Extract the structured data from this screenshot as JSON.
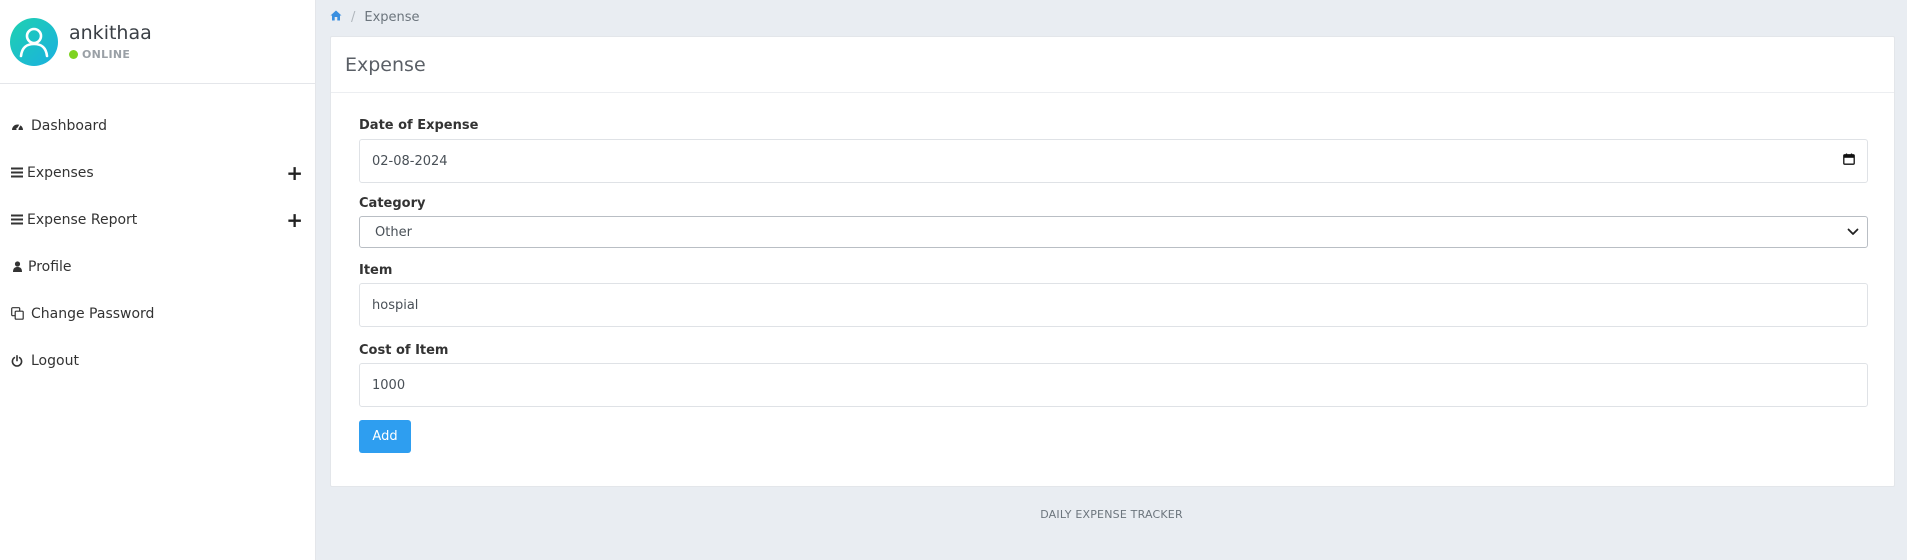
{
  "user": {
    "name": "ankithaa",
    "status": "ONLINE"
  },
  "sidebar": {
    "items": [
      {
        "label": "Dashboard",
        "icon": "dashboard-icon"
      },
      {
        "label": "Expenses",
        "icon": "bars-icon",
        "expandable": true
      },
      {
        "label": "Expense Report",
        "icon": "bars-icon",
        "expandable": true
      },
      {
        "label": "Profile",
        "icon": "user-icon"
      },
      {
        "label": "Change Password",
        "icon": "copy-icon"
      },
      {
        "label": "Logout",
        "icon": "power-icon"
      }
    ],
    "expand_symbol": "+"
  },
  "breadcrumb": {
    "home_icon": "home-icon",
    "separator": "/",
    "current": "Expense"
  },
  "card": {
    "title": "Expense"
  },
  "form": {
    "date": {
      "label": "Date of Expense",
      "value": "02-08-2024"
    },
    "category": {
      "label": "Category",
      "value": "Other"
    },
    "item": {
      "label": "Item",
      "value": "hospial"
    },
    "cost": {
      "label": "Cost of Item",
      "value": "1000"
    },
    "submit_label": "Add"
  },
  "footer": {
    "text": "DAILY EXPENSE TRACKER"
  },
  "colors": {
    "accent": "#2e9ef0",
    "online": "#7ed321",
    "avatar": "#1ab0e0"
  }
}
